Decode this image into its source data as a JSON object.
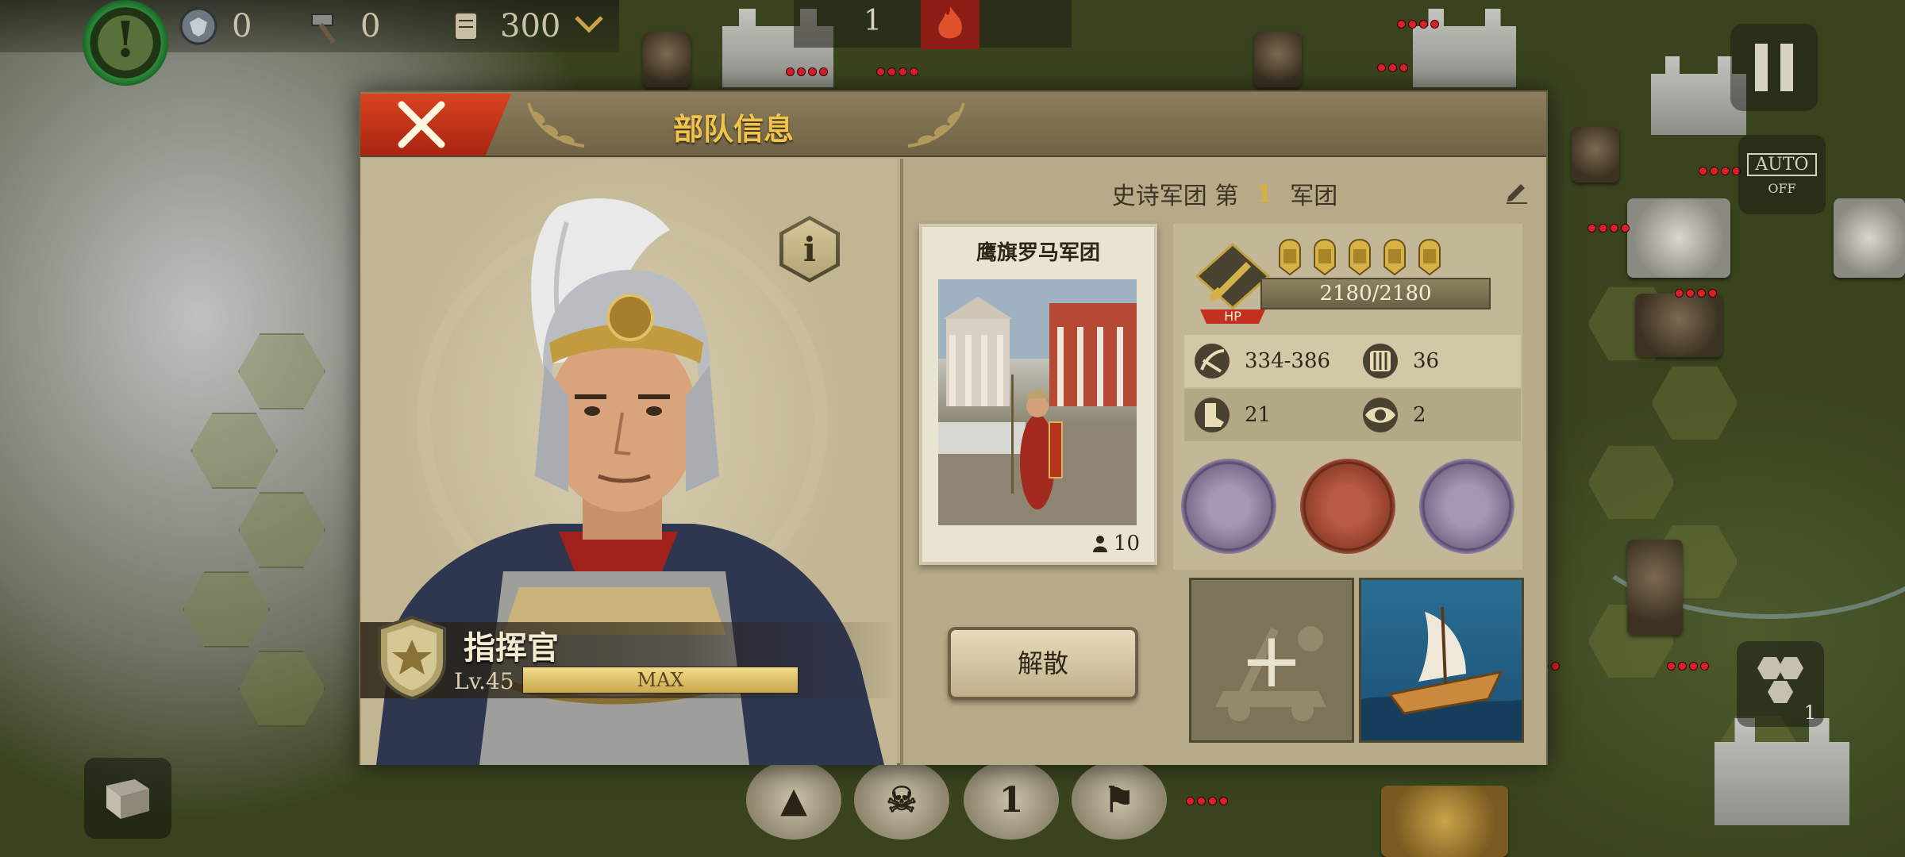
{
  "hud": {
    "alert_symbol": "!",
    "resources": [
      {
        "icon": "shield-eagle-icon",
        "value": "0"
      },
      {
        "icon": "hammer-icon",
        "value": "0"
      },
      {
        "icon": "scroll-icon",
        "value": "300"
      }
    ],
    "top_center_value": "1",
    "auto_label": "AUTO",
    "auto_state": "OFF",
    "hex_button_count": "1",
    "bottom_button_value": "1"
  },
  "dialog": {
    "title": "部队信息",
    "close_icon": "close-icon",
    "commander": {
      "name": "指挥官",
      "level_label": "Lv.45",
      "level_bar_text": "MAX",
      "level_fraction": 1.0
    },
    "legion": {
      "prefix": "史诗军团 第",
      "number": "1",
      "suffix": "军团"
    },
    "unit": {
      "name": "鹰旗罗马军团",
      "soldiers": "10"
    },
    "hp_badge": "HP",
    "hp_value": "2180/2180",
    "medal_count": 5,
    "stats": [
      {
        "icon": "attack-icon",
        "value": "334-386"
      },
      {
        "icon": "defense-icon",
        "value": "36"
      },
      {
        "icon": "movement-icon",
        "value": "21"
      },
      {
        "icon": "vision-icon",
        "value": "2"
      }
    ],
    "skills": [
      "formation-skill-icon",
      "shield-wall-skill-icon",
      "spear-skill-icon"
    ],
    "disband_label": "解散",
    "slot_add_symbol": "+"
  },
  "colors": {
    "title_gold": "#f0c34a",
    "close_red": "#c8381a",
    "hp_red": "#d8222a"
  }
}
